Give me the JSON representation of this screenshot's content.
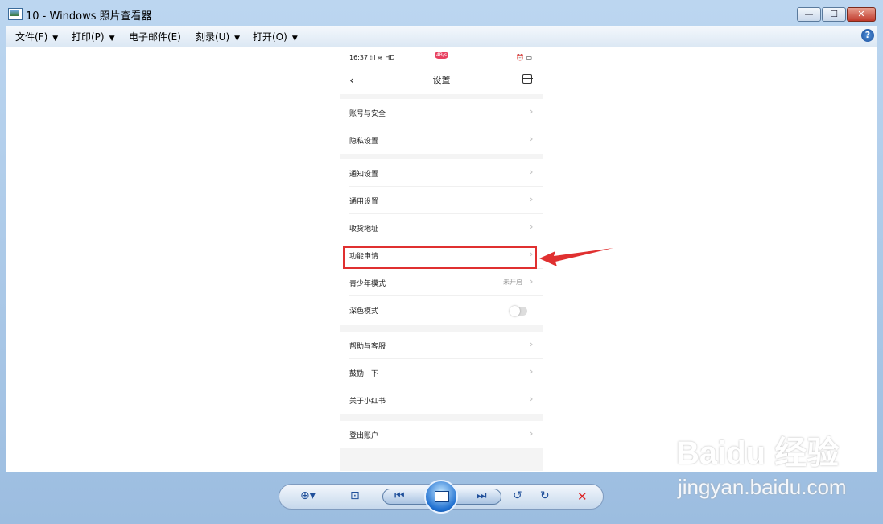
{
  "window": {
    "title": "10 - Windows 照片查看器",
    "minimize": "—",
    "maximize": "☐",
    "close": "✕"
  },
  "menubar": {
    "items": [
      {
        "label": "文件(F)"
      },
      {
        "label": "打印(P)"
      },
      {
        "label": "电子邮件(E)"
      },
      {
        "label": "刻录(U)"
      },
      {
        "label": "打开(O)"
      }
    ],
    "help": "?"
  },
  "phone": {
    "status": {
      "time": "16:37",
      "signal": "⁞ıl ≋ HD",
      "badge": "4B/s",
      "right": "⏰ ▭"
    },
    "nav": {
      "title": "设置",
      "back": "‹"
    },
    "groups": [
      {
        "rows": [
          {
            "label": "账号与安全"
          },
          {
            "label": "隐私设置"
          }
        ]
      },
      {
        "rows": [
          {
            "label": "通知设置"
          },
          {
            "label": "通用设置"
          },
          {
            "label": "收货地址"
          },
          {
            "label": "功能申请"
          },
          {
            "label": "青少年模式",
            "value": "未开启"
          },
          {
            "label": "深色模式",
            "toggle": false
          }
        ]
      },
      {
        "rows": [
          {
            "label": "帮助与客服"
          },
          {
            "label": "鼓励一下"
          },
          {
            "label": "关于小红书"
          }
        ]
      },
      {
        "rows": [
          {
            "label": "登出账户"
          }
        ]
      }
    ],
    "chevron": "›"
  },
  "annotation": {
    "color": "#e03030"
  },
  "toolbar": {
    "zoom": "⊕▾",
    "actual_size": "⊡",
    "prev": "⏮",
    "next": "⏭",
    "rotate_ccw": "↺",
    "rotate_cw": "↻",
    "delete": "✕"
  },
  "watermark": {
    "logo": "Baidu 经验",
    "url": "jingyan.baidu.com"
  }
}
